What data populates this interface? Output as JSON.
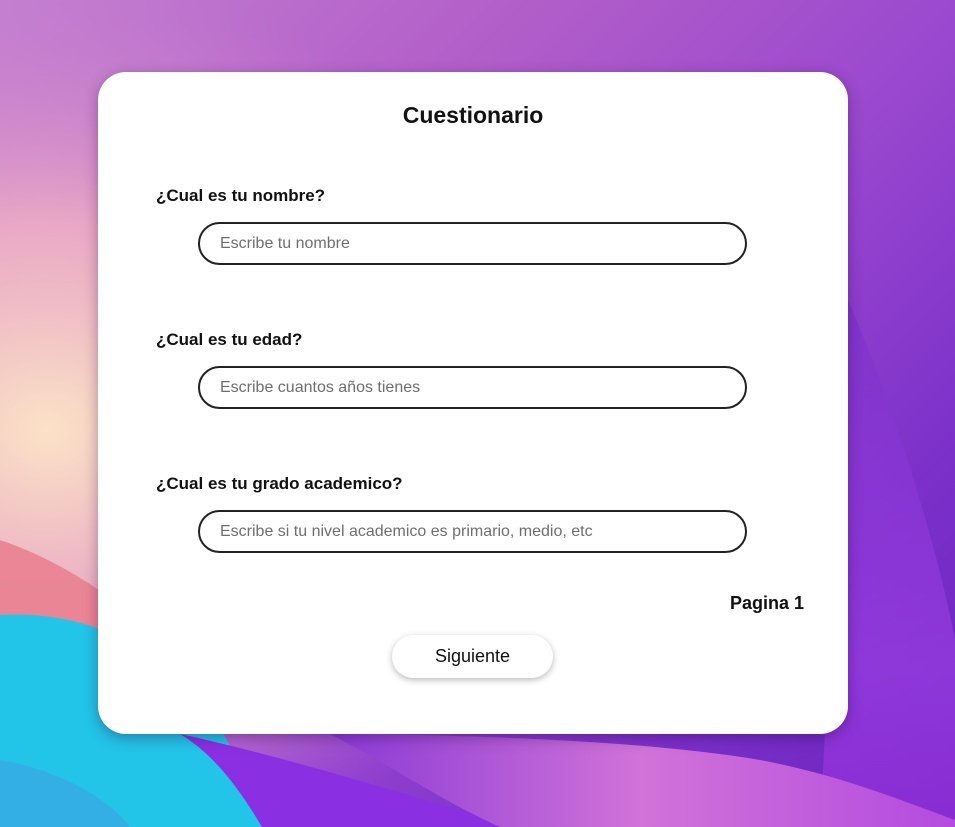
{
  "form": {
    "title": "Cuestionario",
    "questions": [
      {
        "label": "¿Cual es tu nombre?",
        "placeholder": "Escribe tu nombre",
        "value": ""
      },
      {
        "label": "¿Cual es tu edad?",
        "placeholder": "Escribe cuantos años tienes",
        "value": ""
      },
      {
        "label": "¿Cual es tu grado academico?",
        "placeholder": "Escribe si tu nivel academico es primario, medio, etc",
        "value": ""
      }
    ],
    "page_label": "Pagina 1",
    "next_label": "Siguiente"
  },
  "colors": {
    "card_background": "#ffffff",
    "field_border": "#222222",
    "wallpaper_purple": "#9a48cf",
    "wallpaper_cyan": "#22c4e8",
    "wallpaper_peach": "#f6c8b4"
  }
}
